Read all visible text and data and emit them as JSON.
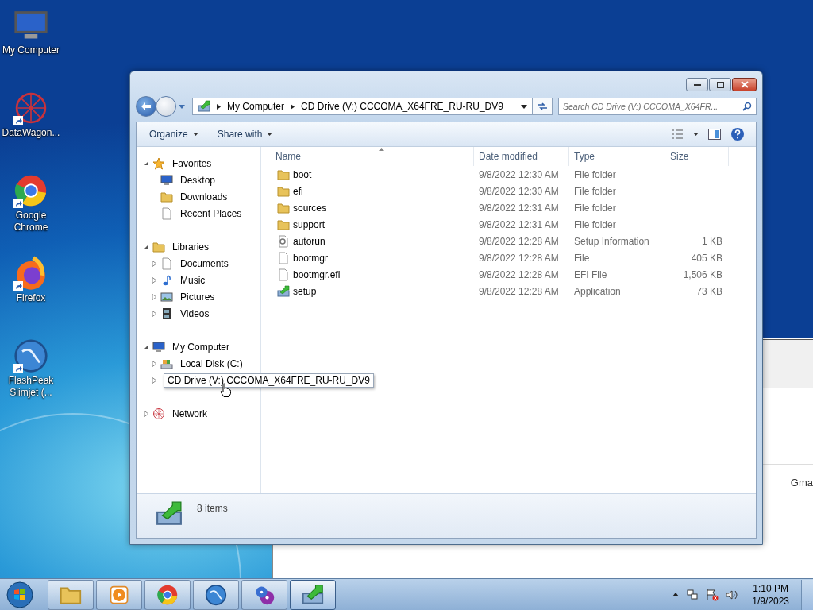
{
  "desktop_icons": [
    {
      "label": "My Computer",
      "kind": "computer",
      "shortcut": false
    },
    {
      "label": "DataWagon...",
      "kind": "network",
      "shortcut": true
    },
    {
      "label": "Google Chrome",
      "kind": "chrome",
      "shortcut": true
    },
    {
      "label": "Firefox",
      "kind": "firefox",
      "shortcut": true
    },
    {
      "label": "FlashPeak Slimjet (...",
      "kind": "globe",
      "shortcut": true
    }
  ],
  "background_window": {
    "text": "Gma"
  },
  "address_bar": {
    "crumbs": [
      "My Computer",
      "CD Drive (V:) CCCOMA_X64FRE_RU-RU_DV9"
    ]
  },
  "search": {
    "placeholder": "Search CD Drive (V:) CCCOMA_X64FR..."
  },
  "toolbar": [
    "Organize",
    "Share with"
  ],
  "nav_pane": [
    {
      "label": "Favorites",
      "kind": "star",
      "expanded": true,
      "children": [
        {
          "label": "Desktop",
          "kind": "desktop"
        },
        {
          "label": "Downloads",
          "kind": "downloads"
        },
        {
          "label": "Recent Places",
          "kind": "recent"
        }
      ]
    },
    {
      "label": "Libraries",
      "kind": "library",
      "expanded": true,
      "children": [
        {
          "label": "Documents",
          "kind": "documents",
          "expanded": false
        },
        {
          "label": "Music",
          "kind": "music",
          "expanded": false
        },
        {
          "label": "Pictures",
          "kind": "pictures",
          "expanded": false
        },
        {
          "label": "Videos",
          "kind": "videos",
          "expanded": false
        }
      ]
    },
    {
      "label": "My Computer",
      "kind": "computer",
      "expanded": true,
      "children": [
        {
          "label": "Local Disk (C:)",
          "kind": "disk",
          "expanded": false
        },
        {
          "label": "CD Drive (V:) CCCOMA_X64FRE_RU-RU_DV9",
          "kind": "cd",
          "expanded": false,
          "hovered": true
        }
      ]
    },
    {
      "label": "Network",
      "kind": "network",
      "expanded": false
    }
  ],
  "file_list": {
    "columns": [
      "Name",
      "Date modified",
      "Type",
      "Size"
    ],
    "rows": [
      {
        "name": "boot",
        "kind": "folder",
        "date": "9/8/2022 12:30 AM",
        "type": "File folder"
      },
      {
        "name": "efi",
        "kind": "folder",
        "date": "9/8/2022 12:30 AM",
        "type": "File folder"
      },
      {
        "name": "sources",
        "kind": "folder",
        "date": "9/8/2022 12:31 AM",
        "type": "File folder"
      },
      {
        "name": "support",
        "kind": "folder",
        "date": "9/8/2022 12:31 AM",
        "type": "File folder"
      },
      {
        "name": "autorun",
        "kind": "setupinfo",
        "date": "9/8/2022 12:28 AM",
        "type": "Setup Information",
        "size": "1 KB"
      },
      {
        "name": "bootmgr",
        "kind": "file",
        "date": "9/8/2022 12:28 AM",
        "type": "File",
        "size": "405 KB"
      },
      {
        "name": "bootmgr.efi",
        "kind": "file",
        "date": "9/8/2022 12:28 AM",
        "type": "EFI File",
        "size": "1,506 KB"
      },
      {
        "name": "setup",
        "kind": "app",
        "date": "9/8/2022 12:28 AM",
        "type": "Application",
        "size": "73 KB"
      }
    ]
  },
  "details_pane": {
    "count": "8 items"
  },
  "taskbar": {
    "items": [
      {
        "kind": "explorer",
        "selected": false
      },
      {
        "kind": "media",
        "selected": false
      },
      {
        "kind": "chrome",
        "selected": false
      },
      {
        "kind": "globe",
        "selected": false
      },
      {
        "kind": "discs",
        "selected": false
      },
      {
        "kind": "cd",
        "selected": true
      }
    ],
    "time": "1:10 PM",
    "date": "1/9/2023"
  }
}
